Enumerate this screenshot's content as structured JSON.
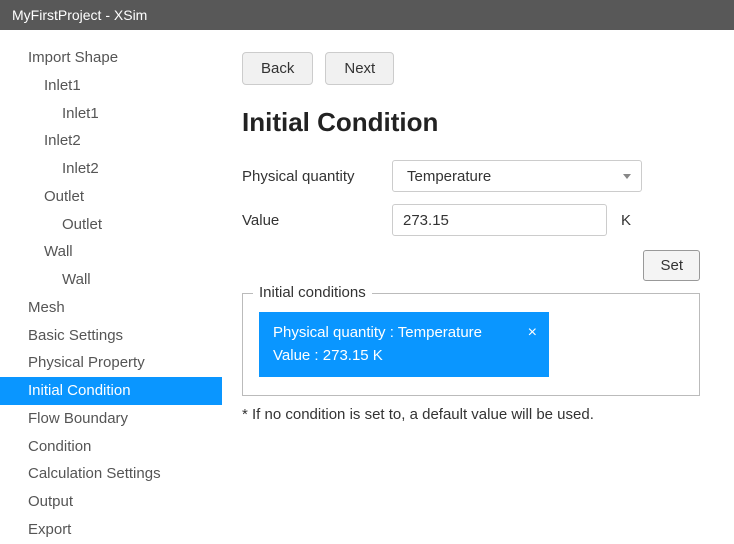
{
  "window": {
    "title": "MyFirstProject - XSim"
  },
  "sidebar": {
    "items": [
      {
        "label": "Import Shape",
        "lvl": 1,
        "sel": false
      },
      {
        "label": "Inlet1",
        "lvl": 2,
        "sel": false
      },
      {
        "label": "Inlet1",
        "lvl": 3,
        "sel": false
      },
      {
        "label": "Inlet2",
        "lvl": 2,
        "sel": false
      },
      {
        "label": "Inlet2",
        "lvl": 3,
        "sel": false
      },
      {
        "label": "Outlet",
        "lvl": 2,
        "sel": false
      },
      {
        "label": "Outlet",
        "lvl": 3,
        "sel": false
      },
      {
        "label": "Wall",
        "lvl": 2,
        "sel": false
      },
      {
        "label": "Wall",
        "lvl": 3,
        "sel": false
      },
      {
        "label": "Mesh",
        "lvl": 1,
        "sel": false
      },
      {
        "label": "Basic Settings",
        "lvl": 1,
        "sel": false
      },
      {
        "label": "Physical Property",
        "lvl": 1,
        "sel": false
      },
      {
        "label": "Initial Condition",
        "lvl": 1,
        "sel": true
      },
      {
        "label": "Flow Boundary",
        "lvl": 1,
        "sel": false
      },
      {
        "label": "Condition",
        "lvl": 1,
        "sel": false
      },
      {
        "label": "Calculation Settings",
        "lvl": 1,
        "sel": false
      },
      {
        "label": "Output",
        "lvl": 1,
        "sel": false
      },
      {
        "label": "Export",
        "lvl": 1,
        "sel": false
      }
    ]
  },
  "nav": {
    "back": "Back",
    "next": "Next"
  },
  "page": {
    "title": "Initial Condition"
  },
  "form": {
    "pq_label": "Physical quantity",
    "pq_value": "Temperature",
    "val_label": "Value",
    "val_value": "273.15",
    "val_unit": "K",
    "set_btn": "Set"
  },
  "conditions": {
    "legend": "Initial conditions",
    "card": {
      "line1": "Physical quantity : Temperature",
      "line2": "Value : 273.15 K",
      "close": "×"
    }
  },
  "footnote": "* If no condition is set to, a default value will be used."
}
